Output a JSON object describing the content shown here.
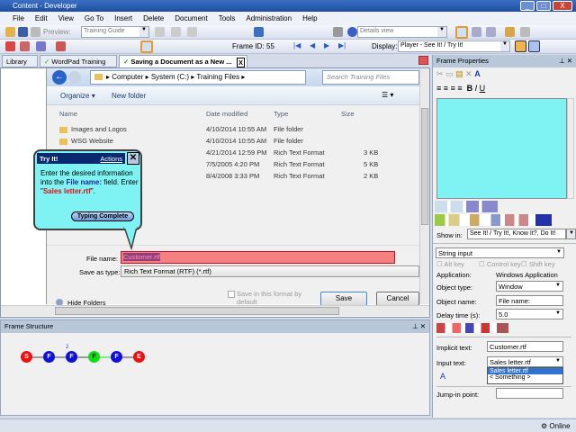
{
  "window": {
    "title": "Content - Developer"
  },
  "menu": [
    "File",
    "Edit",
    "View",
    "Go To",
    "Insert",
    "Delete",
    "Document",
    "Tools",
    "Administration",
    "Help"
  ],
  "toolbar1": {
    "preview_label": "Preview:",
    "preview_value": "Training Guide",
    "view_value": "Details view"
  },
  "toolbar2": {
    "frame_id_label": "Frame ID:",
    "frame_id": "55",
    "display_label": "Display:",
    "display_value": "Player - See It! / Try It!"
  },
  "tabs": [
    {
      "label": "Library"
    },
    {
      "label": "WordPad Training"
    },
    {
      "label": "Saving a Document as a New ...",
      "active": true
    }
  ],
  "dialog": {
    "breadcrumb": [
      "Computer",
      "System (C:)",
      "Training Files"
    ],
    "search_placeholder": "Search Training Files",
    "organize": "Organize",
    "new_folder": "New folder",
    "columns": [
      "Name",
      "Date modified",
      "Type",
      "Size"
    ],
    "rows": [
      {
        "name": "Images and Logos",
        "date": "4/10/2014 10:55 AM",
        "type": "File folder",
        "size": ""
      },
      {
        "name": "WSG Website",
        "date": "4/10/2014 10:55 AM",
        "type": "File folder",
        "size": ""
      },
      {
        "name": "",
        "date": "4/21/2014 12:59 PM",
        "type": "Rich Text Format",
        "size": "3 KB"
      },
      {
        "name": "",
        "date": "7/5/2005 4:20 PM",
        "type": "Rich Text Format",
        "size": "5 KB"
      },
      {
        "name": "",
        "date": "8/4/2008 3:33 PM",
        "type": "Rich Text Format",
        "size": "2 KB"
      }
    ],
    "file_name_label": "File name:",
    "file_name_value": "Customer.rtf",
    "save_type_label": "Save as type:",
    "save_type_value": "Rich Text Format (RTF) (*.rtf)",
    "save_default_label": "Save in this format by default",
    "hide_folders": "Hide Folders",
    "save": "Save",
    "cancel": "Cancel"
  },
  "callout": {
    "title": "Try It!",
    "actions": "Actions",
    "text1": "Enter the desired information into the ",
    "field": "File name:",
    "text2": " field. Enter \"",
    "value": "Sales letter.rtf",
    "text3": "\".",
    "button": "Typing Complete"
  },
  "frame_structure": {
    "title": "Frame Structure",
    "badge": "2",
    "nodes": [
      {
        "l": "S",
        "c": "#ee1111"
      },
      {
        "l": "F",
        "c": "#1010dd"
      },
      {
        "l": "F",
        "c": "#1010dd"
      },
      {
        "l": "F",
        "c": "#11dd11"
      },
      {
        "l": "F",
        "c": "#1010dd"
      },
      {
        "l": "E",
        "c": "#ee1111"
      }
    ]
  },
  "props": {
    "title": "Frame Properties",
    "show_in_label": "Show in:",
    "show_in_value": "See It! / Try It!, Know It?, Do It!",
    "action_type": "String input",
    "alt": "Alt key",
    "ctrl": "Control key",
    "shift": "Shift key",
    "application_label": "Application:",
    "application_value": "Windows Application",
    "object_type_label": "Object type:",
    "object_type_value": "Window",
    "object_name_label": "Object name:",
    "object_name_value": "File name:",
    "delay_label": "Delay time (s):",
    "delay_value": "5.0",
    "implicit_label": "Implicit text:",
    "implicit_value": "Customer.rtf",
    "input_label": "Input text:",
    "input_value": "Sales letter.rtf",
    "input_options": [
      "Sales letter.rtf",
      "< Something >"
    ],
    "jump_label": "Jump-in point:",
    "jump_value": ""
  },
  "status": {
    "online": "Online"
  }
}
